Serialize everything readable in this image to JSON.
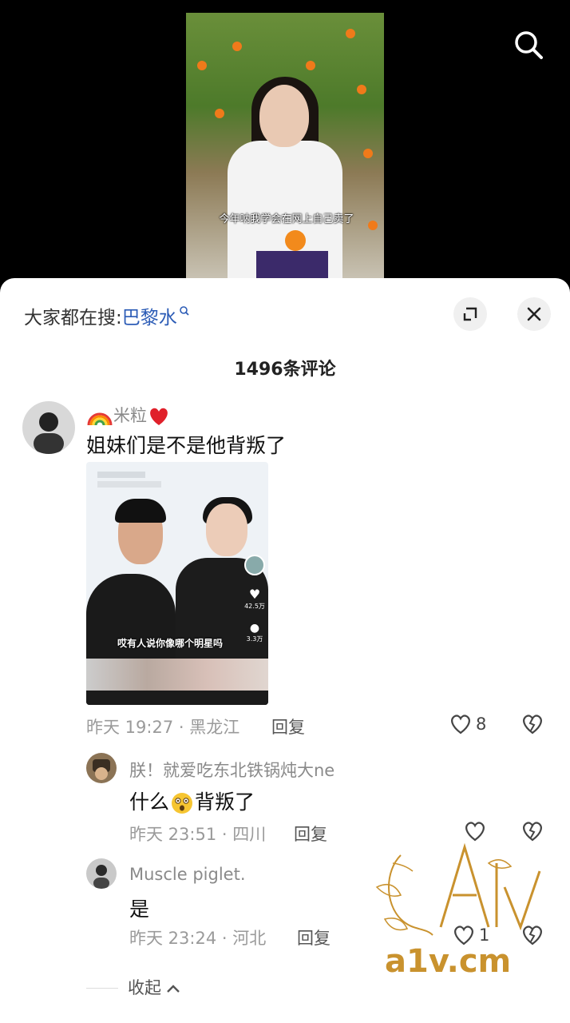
{
  "video": {
    "subtitle": "今年呐我学会在网上自己卖了"
  },
  "icons": {
    "search": "search-icon",
    "expand": "expand-icon",
    "close": "close-icon",
    "heart": "heart-icon",
    "broken_heart": "dislike-icon"
  },
  "header": {
    "hot_search_label": "大家都在搜:",
    "hot_search_term": "巴黎水",
    "comment_count_title": "1496条评论"
  },
  "comments": [
    {
      "username": "米粒",
      "text": "姐妹们是不是他背叛了",
      "image_caption": "哎有人说你像哪个明星吗",
      "image_stats": [
        "42.5万",
        "3.3万"
      ],
      "meta": "昨天 19:27 · 黑龙江",
      "reply_label": "回复",
      "likes": "8"
    },
    {
      "username": "朕！就爱吃东北铁锅炖大ne",
      "text_before": "什么",
      "text_after": "背叛了",
      "meta": "昨天 23:51 · 四川",
      "reply_label": "回复",
      "likes": ""
    },
    {
      "username": "Muscle piglet.",
      "text": "是",
      "meta": "昨天 23:24 · 河北",
      "reply_label": "回复",
      "likes": "1"
    }
  ],
  "collapse_label": "收起",
  "watermark": {
    "text": "a1v.cm"
  },
  "colors": {
    "link_blue": "#2c5cb6",
    "watermark_gold": "#c9922e"
  }
}
